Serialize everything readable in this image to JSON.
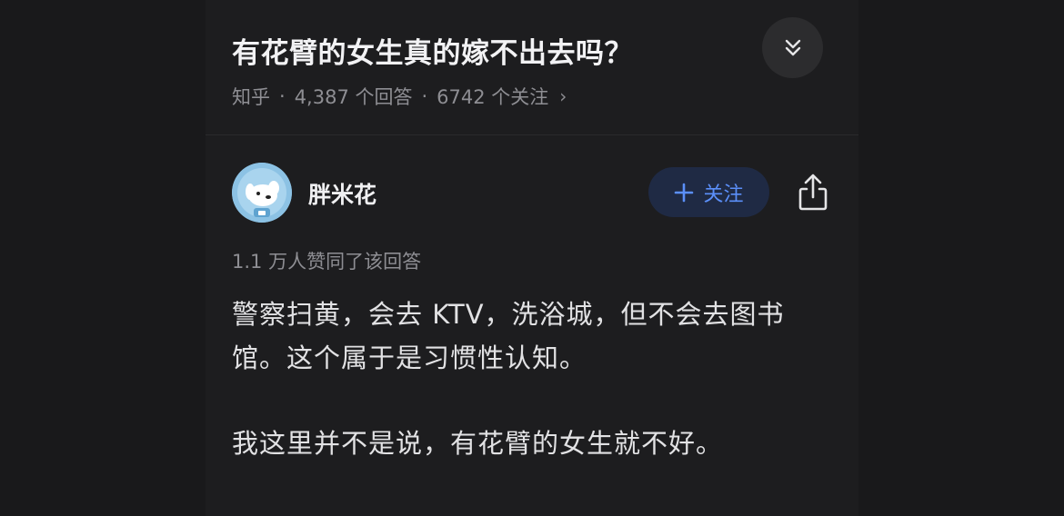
{
  "question": {
    "title": "有花臂的女生真的嫁不出去吗？",
    "source": "知乎",
    "answers_count": "4,387 个回答",
    "followers_count": "6742 个关注",
    "separator": "·",
    "chevron": "›"
  },
  "answer": {
    "author": "胖米花",
    "follow_label": "关注",
    "follow_icon": "plus-icon",
    "upvotes": "1.1 万人赞同了该回答",
    "paragraphs": [
      "警察扫黄，会去 KTV，洗浴城，但不会去图书馆。这个属于是习惯性认知。",
      "我这里并不是说，有花臂的女生就不好。"
    ]
  },
  "colors": {
    "background": "#1d1d1f",
    "accent": "#5b8ff9",
    "follow_bg": "#1f2a44",
    "muted_text": "#8e8e93"
  },
  "icons": {
    "collapse": "double-chevron-down-icon",
    "share": "share-icon",
    "more": "chevron-right-icon"
  }
}
